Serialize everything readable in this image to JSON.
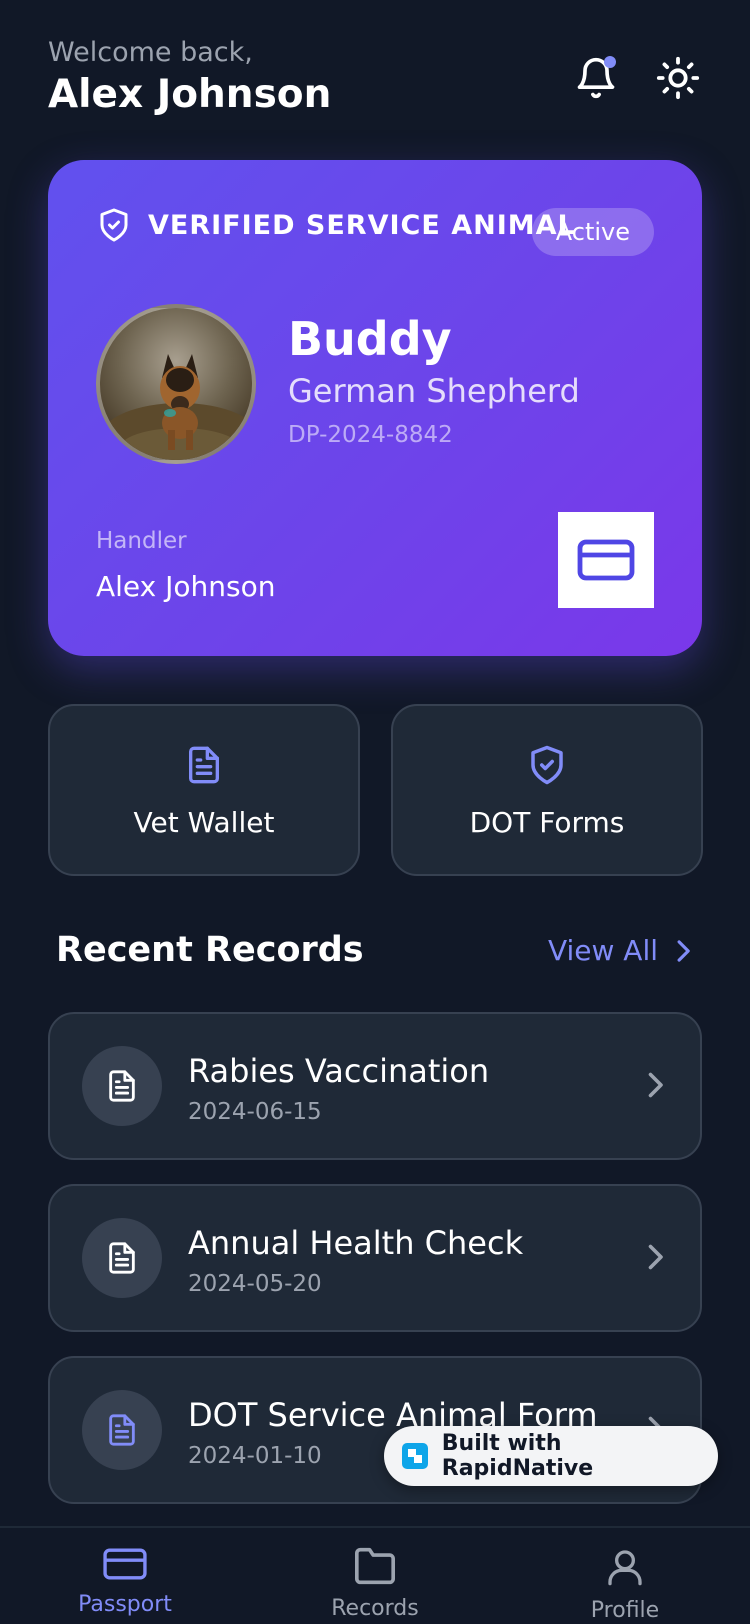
{
  "header": {
    "welcome": "Welcome back,",
    "user_name": "Alex Johnson"
  },
  "icons": {
    "notifications": "bell-icon",
    "theme": "sun-icon"
  },
  "pass_card": {
    "verified_label": "VERIFIED SERVICE ANIMAL",
    "status": "Active",
    "pet_name": "Buddy",
    "breed": "German Shepherd",
    "passport_id": "DP-2024-8842",
    "handler_label": "Handler",
    "handler_name": "Alex Johnson"
  },
  "quick_actions": [
    {
      "label": "Vet Wallet",
      "icon": "document-icon"
    },
    {
      "label": "DOT Forms",
      "icon": "shield-check-icon"
    }
  ],
  "recent_records": {
    "title": "Recent Records",
    "view_all": "View All",
    "items": [
      {
        "title": "Rabies Vaccination",
        "date": "2024-06-15"
      },
      {
        "title": "Annual Health Check",
        "date": "2024-05-20"
      },
      {
        "title": "DOT Service Animal Form",
        "date": "2024-01-10"
      }
    ]
  },
  "badge": {
    "text": "Built with RapidNative"
  },
  "tabs": [
    {
      "label": "Passport",
      "active": true
    },
    {
      "label": "Records",
      "active": false
    },
    {
      "label": "Profile",
      "active": false
    }
  ],
  "colors": {
    "background": "#111827",
    "card_gradient_start": "#6151ee",
    "card_gradient_end": "#7a38ea",
    "accent": "#818cf8",
    "surface": "#1f2937"
  }
}
